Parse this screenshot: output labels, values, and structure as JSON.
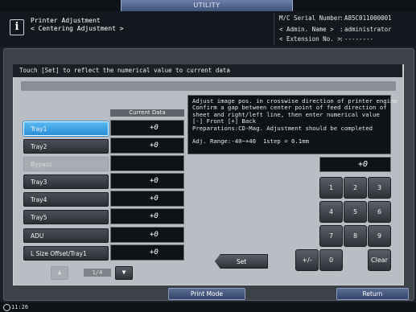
{
  "utility_tab": "UTILITY",
  "header": {
    "title_line1": "Printer Adjustment",
    "title_line2": "< Centering Adjustment >",
    "serial_label": "M/C Serial Number",
    "serial_value": "A85C011000001",
    "admin_label": "< Admin. Name >",
    "admin_value": "administrator",
    "ext_label": "< Extension No. >",
    "ext_value": "--------"
  },
  "instruction": "Touch [Set] to reflect the numerical value to current data",
  "current_data_header": "Current Data",
  "trays": [
    {
      "label": "Tray1",
      "value": "+0",
      "state": "selected"
    },
    {
      "label": "Tray2",
      "value": "+0",
      "state": "normal"
    },
    {
      "label": "Bypass",
      "value": "",
      "state": "disabled"
    },
    {
      "label": "Tray3",
      "value": "+0",
      "state": "normal"
    },
    {
      "label": "Tray4",
      "value": "+0",
      "state": "normal"
    },
    {
      "label": "Tray5",
      "value": "+0",
      "state": "normal"
    },
    {
      "label": "ADU",
      "value": "+0",
      "state": "normal"
    },
    {
      "label": "L Size Offset/Tray1",
      "value": "+0",
      "state": "normal"
    }
  ],
  "description": {
    "lines": [
      "Adjust image pos. in crosswise direction of printer engine",
      "Confirm a gap between center point of feed direction of",
      "sheet and right/left line, then enter numerical value",
      "[-] Front [+] Back",
      "Preparations:CD-Mag. Adjustment should be completed"
    ],
    "range": "Adj. Range:-40~+40  1step = 0.1mm"
  },
  "entry_value": "+0",
  "keypad": {
    "k7": "7",
    "k8": "8",
    "k9": "9",
    "k4": "4",
    "k5": "5",
    "k6": "6",
    "k1": "1",
    "k2": "2",
    "k3": "3",
    "k0": "0",
    "plus_minus": "+/-",
    "clear": "Clear"
  },
  "set_label": "Set",
  "pagination": {
    "up": "▲",
    "down": "▼",
    "indicator": "1/4"
  },
  "print_mode_label": "Print Mode",
  "return_label": "Return",
  "status": {
    "time": "11:26"
  }
}
